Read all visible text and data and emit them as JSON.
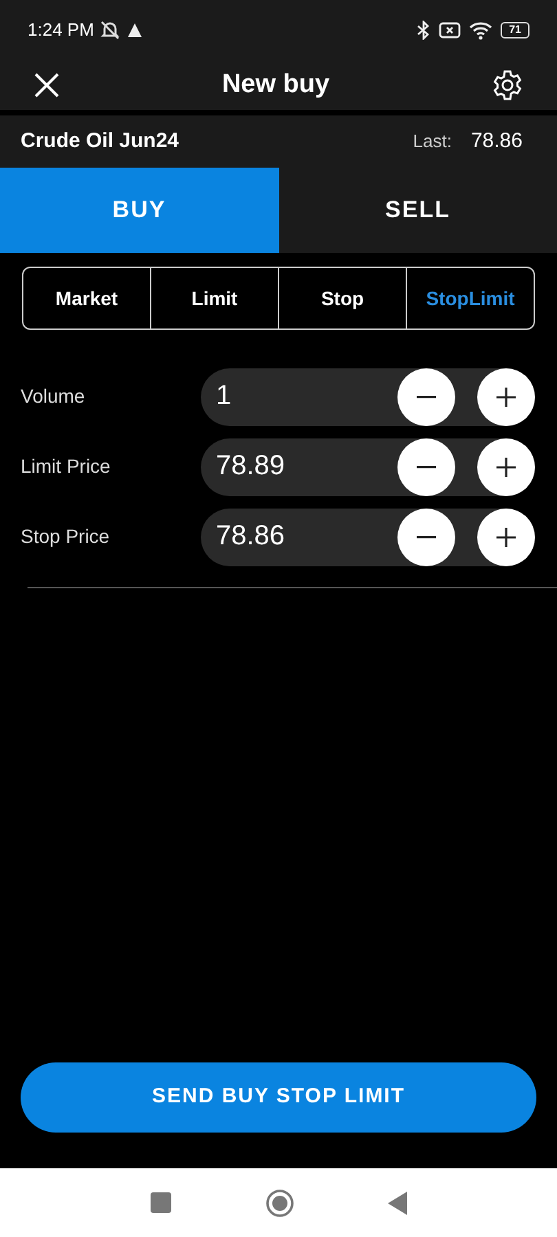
{
  "status_bar": {
    "time": "1:24 PM",
    "battery": "71"
  },
  "header": {
    "title": "New buy"
  },
  "instrument": {
    "name": "Crude Oil Jun24",
    "last_label": "Last:",
    "last_value": "78.86"
  },
  "sides": [
    {
      "label": "BUY",
      "selected": true
    },
    {
      "label": "SELL",
      "selected": false
    }
  ],
  "order_types": [
    {
      "label": "Market",
      "selected": false
    },
    {
      "label": "Limit",
      "selected": false
    },
    {
      "label": "Stop",
      "selected": false
    },
    {
      "label": "StopLimit",
      "selected": true
    }
  ],
  "fields": [
    {
      "label": "Volume",
      "value": "1"
    },
    {
      "label": "Limit Price",
      "value": "78.89"
    },
    {
      "label": "Stop Price",
      "value": "78.86"
    }
  ],
  "submit_button": "SEND BUY STOP LIMIT"
}
